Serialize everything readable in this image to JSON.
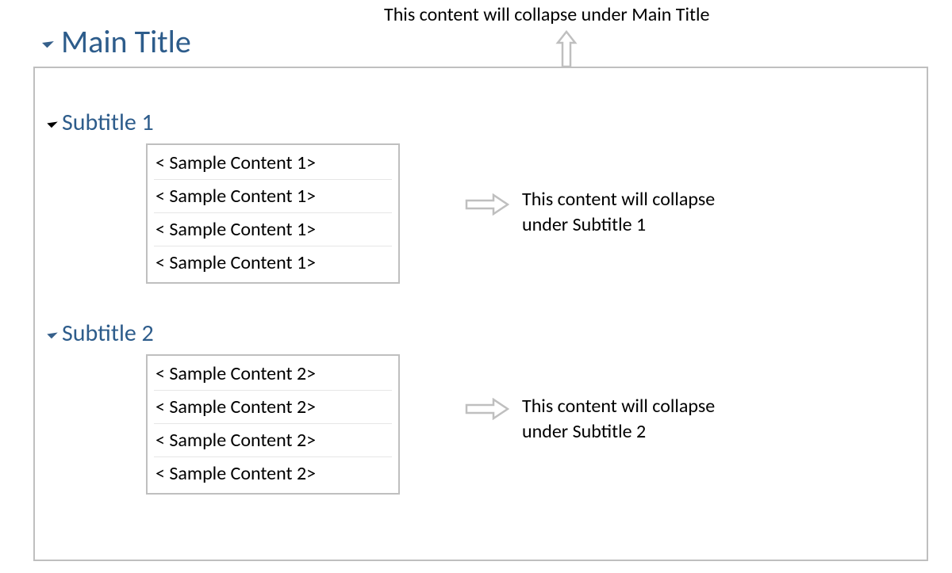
{
  "main_title": "Main Title",
  "top_annotation": "This content will collapse under Main Title",
  "sections": [
    {
      "title": "Subtitle 1",
      "content_lines": [
        "< Sample Content 1>",
        "< Sample Content 1>",
        "< Sample Content 1>",
        "< Sample Content 1>"
      ],
      "annotation_line1": "This content will collapse",
      "annotation_line2": "under Subtitle 1"
    },
    {
      "title": "Subtitle 2",
      "content_lines": [
        "< Sample Content 2>",
        "< Sample Content 2>",
        "< Sample Content 2>",
        "< Sample Content 2>"
      ],
      "annotation_line1": "This content will collapse",
      "annotation_line2": "under Subtitle 2"
    }
  ],
  "colors": {
    "heading_color": "#2d5c8b",
    "border_gray": "#bfbfbf",
    "arrow_gray": "#bfbfbf"
  }
}
